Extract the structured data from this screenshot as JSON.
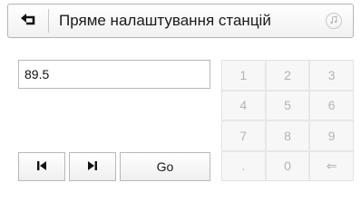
{
  "header": {
    "back_icon": "back-arrow-icon",
    "title": "Пряме налаштування станцій",
    "music_icon": "music-note-icon"
  },
  "frequency": {
    "value": "89.5"
  },
  "controls": {
    "prev_icon": "skip-previous-icon",
    "next_icon": "skip-next-icon",
    "go_label": "Go"
  },
  "keypad": {
    "keys": [
      "1",
      "2",
      "3",
      "4",
      "5",
      "6",
      "7",
      "8",
      "9",
      ".",
      "0",
      "⇐"
    ],
    "enabled": false
  },
  "colors": {
    "border": "#b8b8b8",
    "disabled_text": "#b4b4b4",
    "text": "#1a1a1a"
  }
}
